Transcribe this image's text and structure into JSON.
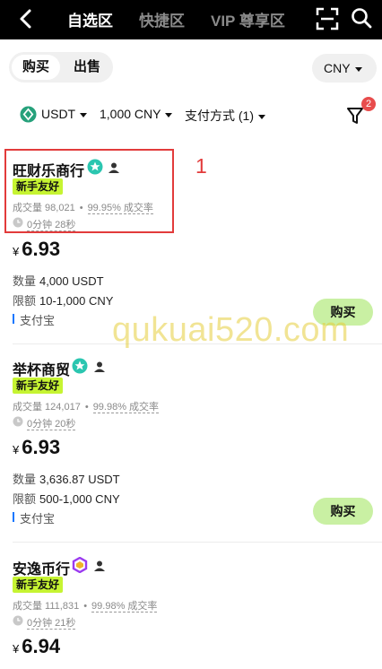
{
  "topbar": {
    "tabs": [
      {
        "label": "自选区",
        "active": true
      },
      {
        "label": "快捷区",
        "active": false
      },
      {
        "label": "VIP 尊享区",
        "active": false
      }
    ]
  },
  "trade_toggle": {
    "buy_label": "购买",
    "sell_label": "出售",
    "selected": "购买"
  },
  "currency_select": {
    "value": "CNY"
  },
  "filters": {
    "coin": "USDT",
    "amount": "1,000 CNY",
    "payment": "支付方式 (1)",
    "badge_count": "2"
  },
  "merchants": [
    {
      "name": "旺财乐商行",
      "tag": "新手友好",
      "volume": "成交量 98,021",
      "rate": "99.95% 成交率",
      "time": "0分钟 28秒",
      "currency_symbol": "¥",
      "price": "6.93",
      "quantity_label": "数量",
      "quantity": "4,000 USDT",
      "limit_label": "限额",
      "limit": "10-1,000 CNY",
      "payment": "支付宝",
      "button_label": "购买",
      "badge_color": "#2bc6b0"
    },
    {
      "name": "举杯商贸",
      "tag": "新手友好",
      "volume": "成交量 124,017",
      "rate": "99.98% 成交率",
      "time": "0分钟 20秒",
      "currency_symbol": "¥",
      "price": "6.93",
      "quantity_label": "数量",
      "quantity": "3,636.87 USDT",
      "limit_label": "限额",
      "limit": "500-1,000 CNY",
      "payment": "支付宝",
      "button_label": "购买",
      "badge_color": "#2bc6b0"
    },
    {
      "name": "安逸币行",
      "tag": "新手友好",
      "volume": "成交量 111,831",
      "rate": "99.98% 成交率",
      "time": "0分钟 21秒",
      "currency_symbol": "¥",
      "price": "6.94",
      "badge_color": "#9b3bf0"
    }
  ],
  "annotation": {
    "number": "1",
    "color": "#e23b3b"
  },
  "watermark": "qukuai520.com"
}
